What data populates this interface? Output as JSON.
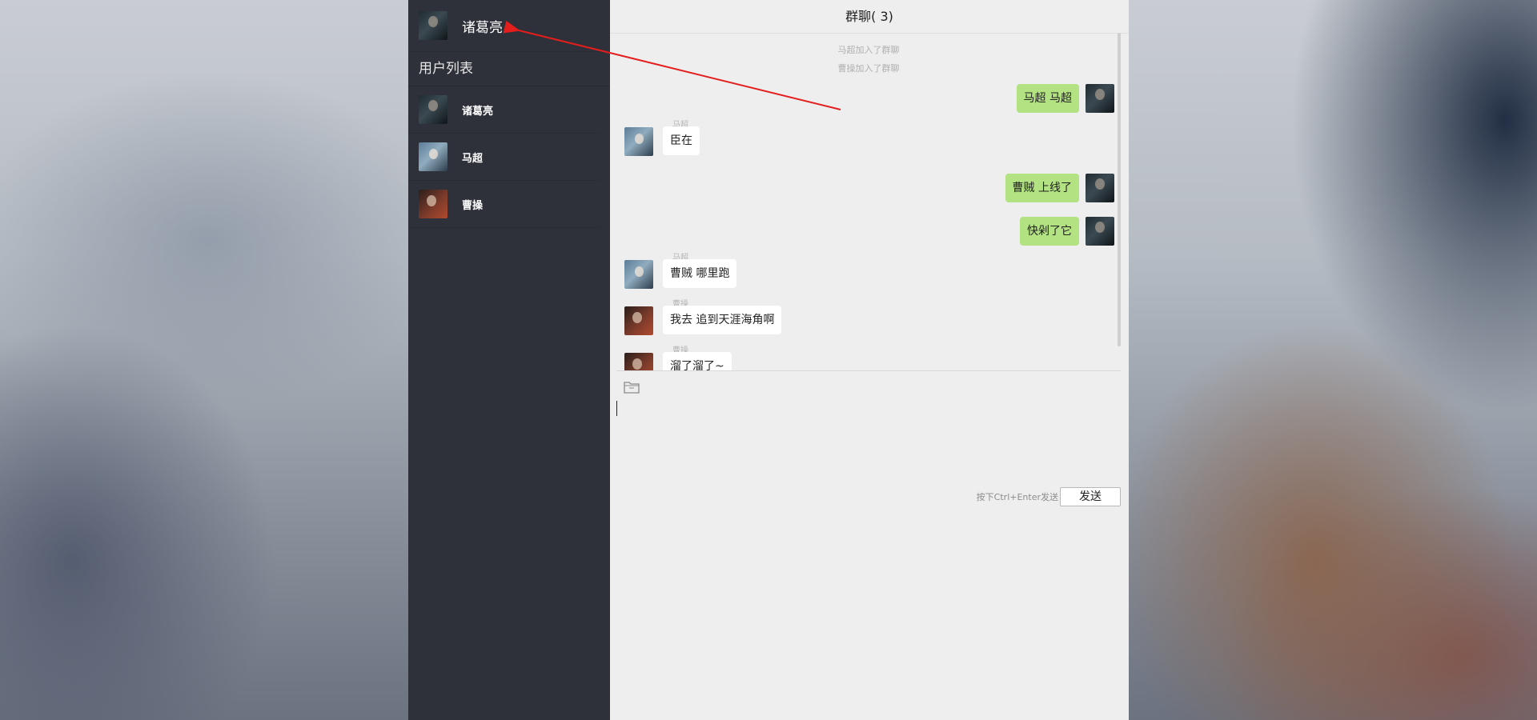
{
  "sidebar": {
    "current_user": {
      "name": "诸葛亮",
      "avatar": "zhuge-liang-avatar"
    },
    "list_title": "用户列表",
    "users": [
      {
        "name": "诸葛亮",
        "avatar": "zhuge-liang-avatar"
      },
      {
        "name": "马超",
        "avatar": "ma-chao-avatar"
      },
      {
        "name": "曹操",
        "avatar": "cao-cao-avatar"
      }
    ]
  },
  "chat": {
    "title": "群聊( 3)",
    "system_messages": [
      "马超加入了群聊",
      "曹操加入了群聊"
    ],
    "messages": [
      {
        "sender": "self",
        "text": "马超 马超"
      },
      {
        "sender": "马超",
        "text": "臣在"
      },
      {
        "sender": "self",
        "text": "曹贼 上线了"
      },
      {
        "sender": "self",
        "text": "快剁了它"
      },
      {
        "sender": "马超",
        "text": "曹贼 哪里跑"
      },
      {
        "sender": "曹操",
        "text": "我去 追到天涯海角啊"
      },
      {
        "sender": "曹操",
        "text": "溜了溜了~"
      }
    ]
  },
  "composer": {
    "toolbar_icon": "folder-icon",
    "hint": "按下Ctrl+Enter发送",
    "send_label": "发送",
    "value": ""
  },
  "colors": {
    "sidebar_bg": "#2e3139",
    "chat_bg": "#eeeeee",
    "self_bubble": "#b2e281",
    "other_bubble": "#ffffff",
    "annotation_arrow": "#e41d1d"
  }
}
